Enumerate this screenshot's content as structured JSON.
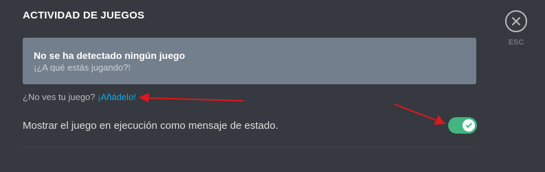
{
  "section": {
    "title": "ACTIVIDAD DE JUEGOS"
  },
  "close": {
    "esc_label": "ESC",
    "icon": "close-icon"
  },
  "no_game_box": {
    "title": "No se ha detectado ningún juego",
    "subtitle": "¡¿A qué estás jugando?!"
  },
  "add_game": {
    "prompt": "¿No ves tu juego?",
    "link_label": "¡Añádelo!"
  },
  "status_setting": {
    "label": "Mostrar el juego en ejecución como mensaje de estado.",
    "enabled": true
  },
  "colors": {
    "background": "#36393f",
    "box": "#747f8d",
    "link": "#00b0f4",
    "toggle_on": "#43b581",
    "annotation_arrow": "#e0181b"
  }
}
